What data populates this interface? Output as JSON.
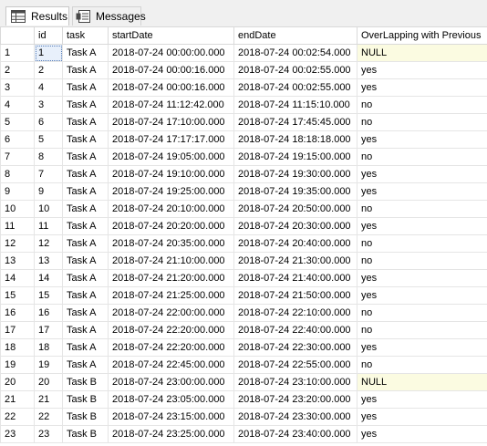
{
  "tabs": [
    {
      "label": "Results",
      "icon": "grid-icon",
      "active": true
    },
    {
      "label": "Messages",
      "icon": "messages-icon",
      "active": false
    }
  ],
  "grid": {
    "columns": [
      "",
      "id",
      "task",
      "startDate",
      "endDate",
      "OverLapping with Previous"
    ],
    "rows": [
      [
        "1",
        "1",
        "Task A",
        "2018-07-24 00:00:00.000",
        "2018-07-24 00:02:54.000",
        "NULL"
      ],
      [
        "2",
        "2",
        "Task A",
        "2018-07-24 00:00:16.000",
        "2018-07-24 00:02:55.000",
        "yes"
      ],
      [
        "3",
        "4",
        "Task A",
        "2018-07-24 00:00:16.000",
        "2018-07-24 00:02:55.000",
        "yes"
      ],
      [
        "4",
        "3",
        "Task A",
        "2018-07-24 11:12:42.000",
        "2018-07-24 11:15:10.000",
        "no"
      ],
      [
        "5",
        "6",
        "Task A",
        "2018-07-24 17:10:00.000",
        "2018-07-24 17:45:45.000",
        "no"
      ],
      [
        "6",
        "5",
        "Task A",
        "2018-07-24 17:17:17.000",
        "2018-07-24 18:18:18.000",
        "yes"
      ],
      [
        "7",
        "8",
        "Task A",
        "2018-07-24 19:05:00.000",
        "2018-07-24 19:15:00.000",
        "no"
      ],
      [
        "8",
        "7",
        "Task A",
        "2018-07-24 19:10:00.000",
        "2018-07-24 19:30:00.000",
        "yes"
      ],
      [
        "9",
        "9",
        "Task A",
        "2018-07-24 19:25:00.000",
        "2018-07-24 19:35:00.000",
        "yes"
      ],
      [
        "10",
        "10",
        "Task A",
        "2018-07-24 20:10:00.000",
        "2018-07-24 20:50:00.000",
        "no"
      ],
      [
        "11",
        "11",
        "Task A",
        "2018-07-24 20:20:00.000",
        "2018-07-24 20:30:00.000",
        "yes"
      ],
      [
        "12",
        "12",
        "Task A",
        "2018-07-24 20:35:00.000",
        "2018-07-24 20:40:00.000",
        "no"
      ],
      [
        "13",
        "13",
        "Task A",
        "2018-07-24 21:10:00.000",
        "2018-07-24 21:30:00.000",
        "no"
      ],
      [
        "14",
        "14",
        "Task A",
        "2018-07-24 21:20:00.000",
        "2018-07-24 21:40:00.000",
        "yes"
      ],
      [
        "15",
        "15",
        "Task A",
        "2018-07-24 21:25:00.000",
        "2018-07-24 21:50:00.000",
        "yes"
      ],
      [
        "16",
        "16",
        "Task A",
        "2018-07-24 22:00:00.000",
        "2018-07-24 22:10:00.000",
        "no"
      ],
      [
        "17",
        "17",
        "Task A",
        "2018-07-24 22:20:00.000",
        "2018-07-24 22:40:00.000",
        "no"
      ],
      [
        "18",
        "18",
        "Task A",
        "2018-07-24 22:20:00.000",
        "2018-07-24 22:30:00.000",
        "yes"
      ],
      [
        "19",
        "19",
        "Task A",
        "2018-07-24 22:45:00.000",
        "2018-07-24 22:55:00.000",
        "no"
      ],
      [
        "20",
        "20",
        "Task B",
        "2018-07-24 23:00:00.000",
        "2018-07-24 23:10:00.000",
        "NULL"
      ],
      [
        "21",
        "21",
        "Task B",
        "2018-07-24 23:05:00.000",
        "2018-07-24 23:20:00.000",
        "yes"
      ],
      [
        "22",
        "22",
        "Task B",
        "2018-07-24 23:15:00.000",
        "2018-07-24 23:30:00.000",
        "yes"
      ],
      [
        "23",
        "23",
        "Task B",
        "2018-07-24 23:25:00.000",
        "2018-07-24 23:40:00.000",
        "yes"
      ]
    ]
  },
  "colors": {
    "null_cell_bg": "#fbfbe1",
    "selected_cell_bg": "#e8f0fb",
    "tab_bar_bg": "#f0f0f0",
    "grid_line": "#e5e5e5"
  }
}
